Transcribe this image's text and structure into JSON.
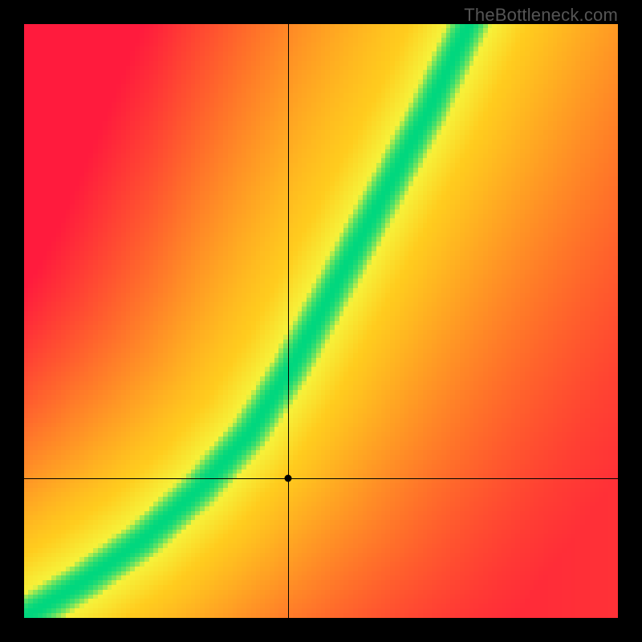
{
  "watermark": "TheBottleneck.com",
  "chart_data": {
    "type": "heatmap",
    "title": "",
    "xlabel": "",
    "ylabel": "",
    "xlim": [
      0,
      1
    ],
    "ylim": [
      0,
      1
    ],
    "grid": false,
    "legend": false,
    "resolution": 128,
    "curve": {
      "description": "Green optimal band rising from bottom-left to top, steeper after midpoint; red far from curve; yellow near it.",
      "points": [
        {
          "x": 0.0,
          "y": 0.0
        },
        {
          "x": 0.1,
          "y": 0.06
        },
        {
          "x": 0.2,
          "y": 0.13
        },
        {
          "x": 0.3,
          "y": 0.22
        },
        {
          "x": 0.38,
          "y": 0.31
        },
        {
          "x": 0.45,
          "y": 0.42
        },
        {
          "x": 0.52,
          "y": 0.55
        },
        {
          "x": 0.6,
          "y": 0.7
        },
        {
          "x": 0.68,
          "y": 0.85
        },
        {
          "x": 0.75,
          "y": 1.0
        }
      ],
      "green_halfwidth": 0.035,
      "yellow_halfwidth": 0.09
    },
    "colors": {
      "green": "#00d77e",
      "yellow_inner": "#f6f23a",
      "yellow_outer": "#ffcc1e",
      "orange": "#ff8a1d",
      "red": "#ff1b3d"
    },
    "crosshair": {
      "x": 0.445,
      "y": 0.235
    },
    "marker": {
      "x": 0.445,
      "y": 0.235,
      "radius_px": 4.5
    }
  }
}
